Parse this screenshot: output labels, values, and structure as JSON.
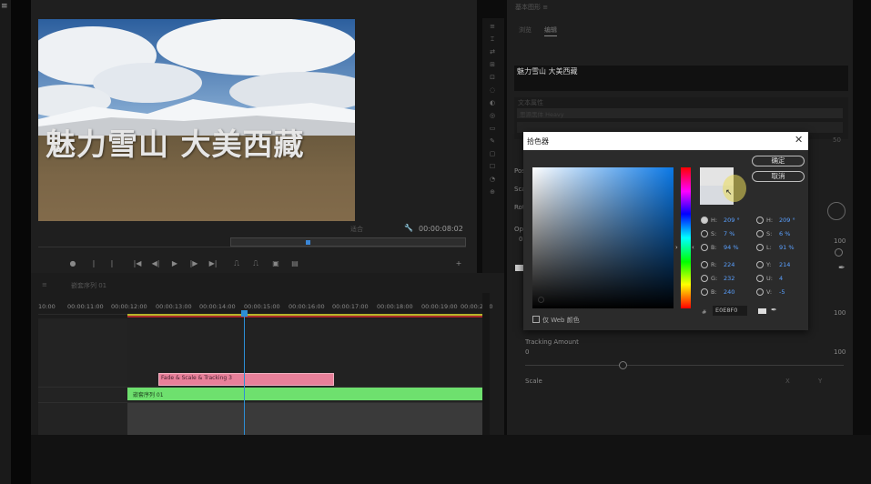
{
  "app": {
    "menu_icon": "hamburger-icon"
  },
  "program_monitor": {
    "video_title": "魅力雪山 大美西藏",
    "timecode_in": "适合",
    "timecode_duration": "00:00:08:02",
    "transport_icons": [
      "marker-icon",
      "mark-in-icon",
      "mark-out-icon",
      "go-to-in-icon",
      "step-back-icon",
      "play-icon",
      "step-forward-icon",
      "go-to-out-icon",
      "lift-icon",
      "extract-icon",
      "export-frame-icon",
      "compare-icon",
      "add-icon"
    ]
  },
  "essential_graphics": {
    "title": "基本图形 ≡",
    "tabs": [
      "浏览",
      "编辑"
    ],
    "layer_name": "魅力雪山 大美西藏",
    "text_section_header": "文本属性",
    "font_value": "思源黑体 Heavy",
    "labels": {
      "position": "Pos",
      "scale": "Sca",
      "rotation": "Rot",
      "opacity": "Opa",
      "opacity_value": "0",
      "right_100_a": "100",
      "right_100_b": "100",
      "style_value": "50"
    },
    "tracking": {
      "label": "Tracking Amount",
      "min": "0",
      "max": "100"
    },
    "scale_row": {
      "label": "Scale",
      "x": "X",
      "y": "Y"
    }
  },
  "color_picker": {
    "title": "拾色器",
    "ok_label": "确定",
    "cancel_label": "取消",
    "hex_prefix": "#",
    "hex_value": "E0E8F0",
    "web_only_label": "仅 Web 颜色",
    "left_fields": [
      {
        "label": "H:",
        "value": "209 °",
        "selected": true
      },
      {
        "label": "S:",
        "value": "7 %",
        "selected": false
      },
      {
        "label": "B:",
        "value": "94 %",
        "selected": false
      },
      {
        "label": "R:",
        "value": "224",
        "selected": false
      },
      {
        "label": "G:",
        "value": "232",
        "selected": false
      },
      {
        "label": "B:",
        "value": "240",
        "selected": false
      }
    ],
    "right_fields": [
      {
        "label": "H:",
        "value": "209 °"
      },
      {
        "label": "S:",
        "value": "6 %"
      },
      {
        "label": "L:",
        "value": "91 %"
      },
      {
        "label": "Y:",
        "value": "214"
      },
      {
        "label": "U:",
        "value": "4"
      },
      {
        "label": "V:",
        "value": "-5"
      }
    ],
    "colors": {
      "gradient_hue": "#0a78e6",
      "new_color": "#e4e4e4",
      "old_color": "#d8dbe0"
    }
  },
  "timeline": {
    "tabs": [
      "≡",
      "嵌套序列 01"
    ],
    "ruler_ticks": [
      "10:00",
      "00:00:11:00",
      "00:00:12:00",
      "00:00:13:00",
      "00:00:14:00",
      "00:00:15:00",
      "00:00:16:00",
      "00:00:17:00",
      "00:00:18:00",
      "00:00:19:00",
      "00:00:20:0"
    ],
    "clips": {
      "pink_label": "Fade & Scale & Tracking 3",
      "green_label": "嵌套序列 01"
    },
    "colors": {
      "pink_clip": "#e8809a",
      "green_clip": "#6ee06e",
      "playhead": "#2d8fd6"
    }
  }
}
